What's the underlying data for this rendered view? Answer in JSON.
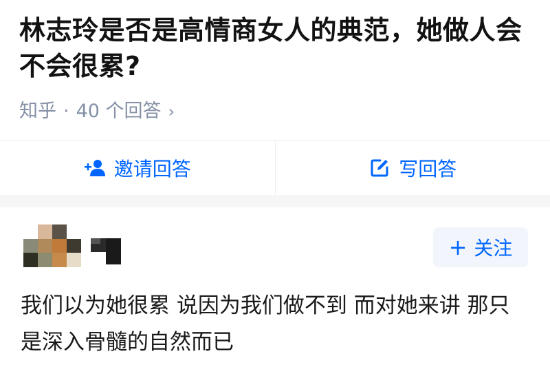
{
  "question": {
    "title": "林志玲是否是高情商女人的典范，她做人会不会很累?"
  },
  "meta": {
    "source": "知乎",
    "separator": "·",
    "answer_count": "40 个回答",
    "chevron": "›"
  },
  "actions": {
    "invite_label": "邀请回答",
    "invite_icon": "add-user-icon",
    "write_label": "写回答",
    "write_icon": "edit-icon",
    "accent_color": "#0066ff"
  },
  "answer": {
    "follow_label": "关注",
    "follow_plus": "+",
    "text": "我们以为她很累 说因为我们做不到 而对她来讲 那只是深入骨髓的自然而已"
  }
}
